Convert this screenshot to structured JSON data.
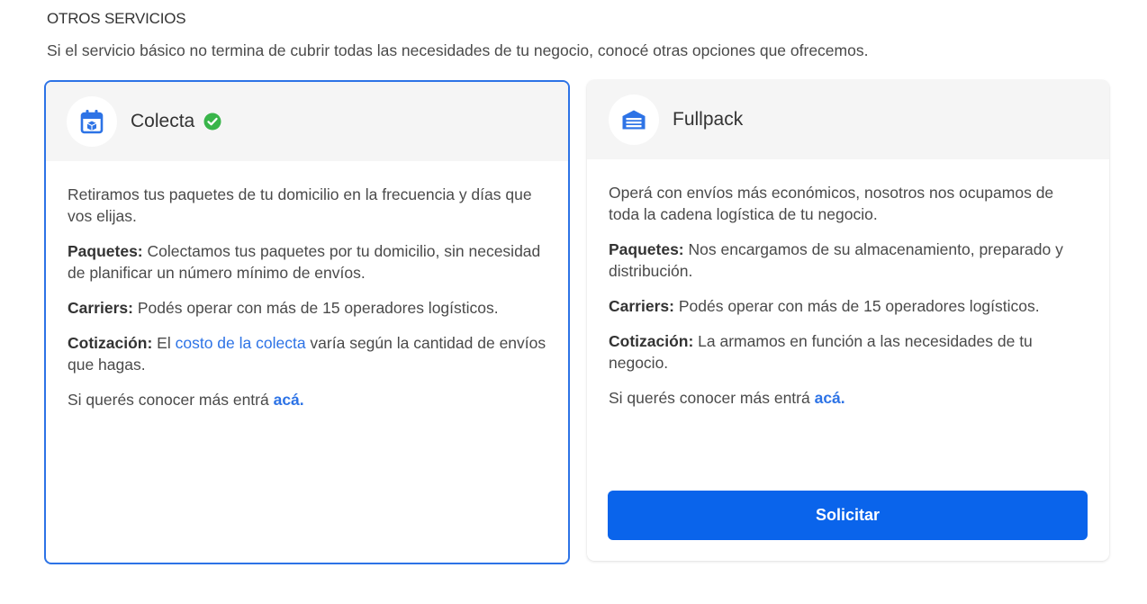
{
  "section": {
    "title": "OTROS SERVICIOS",
    "description": "Si el servicio básico no termina de cubrir todas las necesidades de tu negocio, conocé otras opciones que ofrecemos."
  },
  "colecta": {
    "title": "Colecta",
    "icon": "calendar-box-icon",
    "status_icon": "check-circle-icon",
    "intro": "Retiramos tus paquetes de tu domicilio en la frecuencia y días que vos elijas.",
    "paquetes_label": "Paquetes:",
    "paquetes_text": " Colectamos tus paquetes por tu domicilio, sin necesidad de planificar un número mínimo de envíos.",
    "carriers_label": "Carriers:",
    "carriers_text": " Podés operar con más de 15 operadores logísticos.",
    "cotizacion_label": "Cotización:",
    "cotizacion_pre": " El ",
    "cotizacion_link": "costo de la colecta",
    "cotizacion_post": " varía según la cantidad de envíos que hagas.",
    "more_text": "Si querés conocer más entrá ",
    "more_link": "acá."
  },
  "fullpack": {
    "title": "Fullpack",
    "icon": "warehouse-icon",
    "intro": "Operá con envíos más económicos, nosotros nos ocupamos de toda la cadena logística de tu negocio.",
    "paquetes_label": "Paquetes:",
    "paquetes_text": " Nos encargamos de su almacenamiento, preparado y distribución.",
    "carriers_label": "Carriers:",
    "carriers_text": " Podés operar con más de 15 operadores logísticos.",
    "cotizacion_label": "Cotización:",
    "cotizacion_text": " La armamos en función a las necesidades de tu negocio.",
    "more_text": "Si querés conocer más entrá ",
    "more_link": "acá.",
    "button_label": "Solicitar"
  },
  "colors": {
    "accent": "#2d73e6",
    "button": "#0a64eb",
    "check": "#39b54a",
    "header_bg": "#f5f5f5"
  }
}
